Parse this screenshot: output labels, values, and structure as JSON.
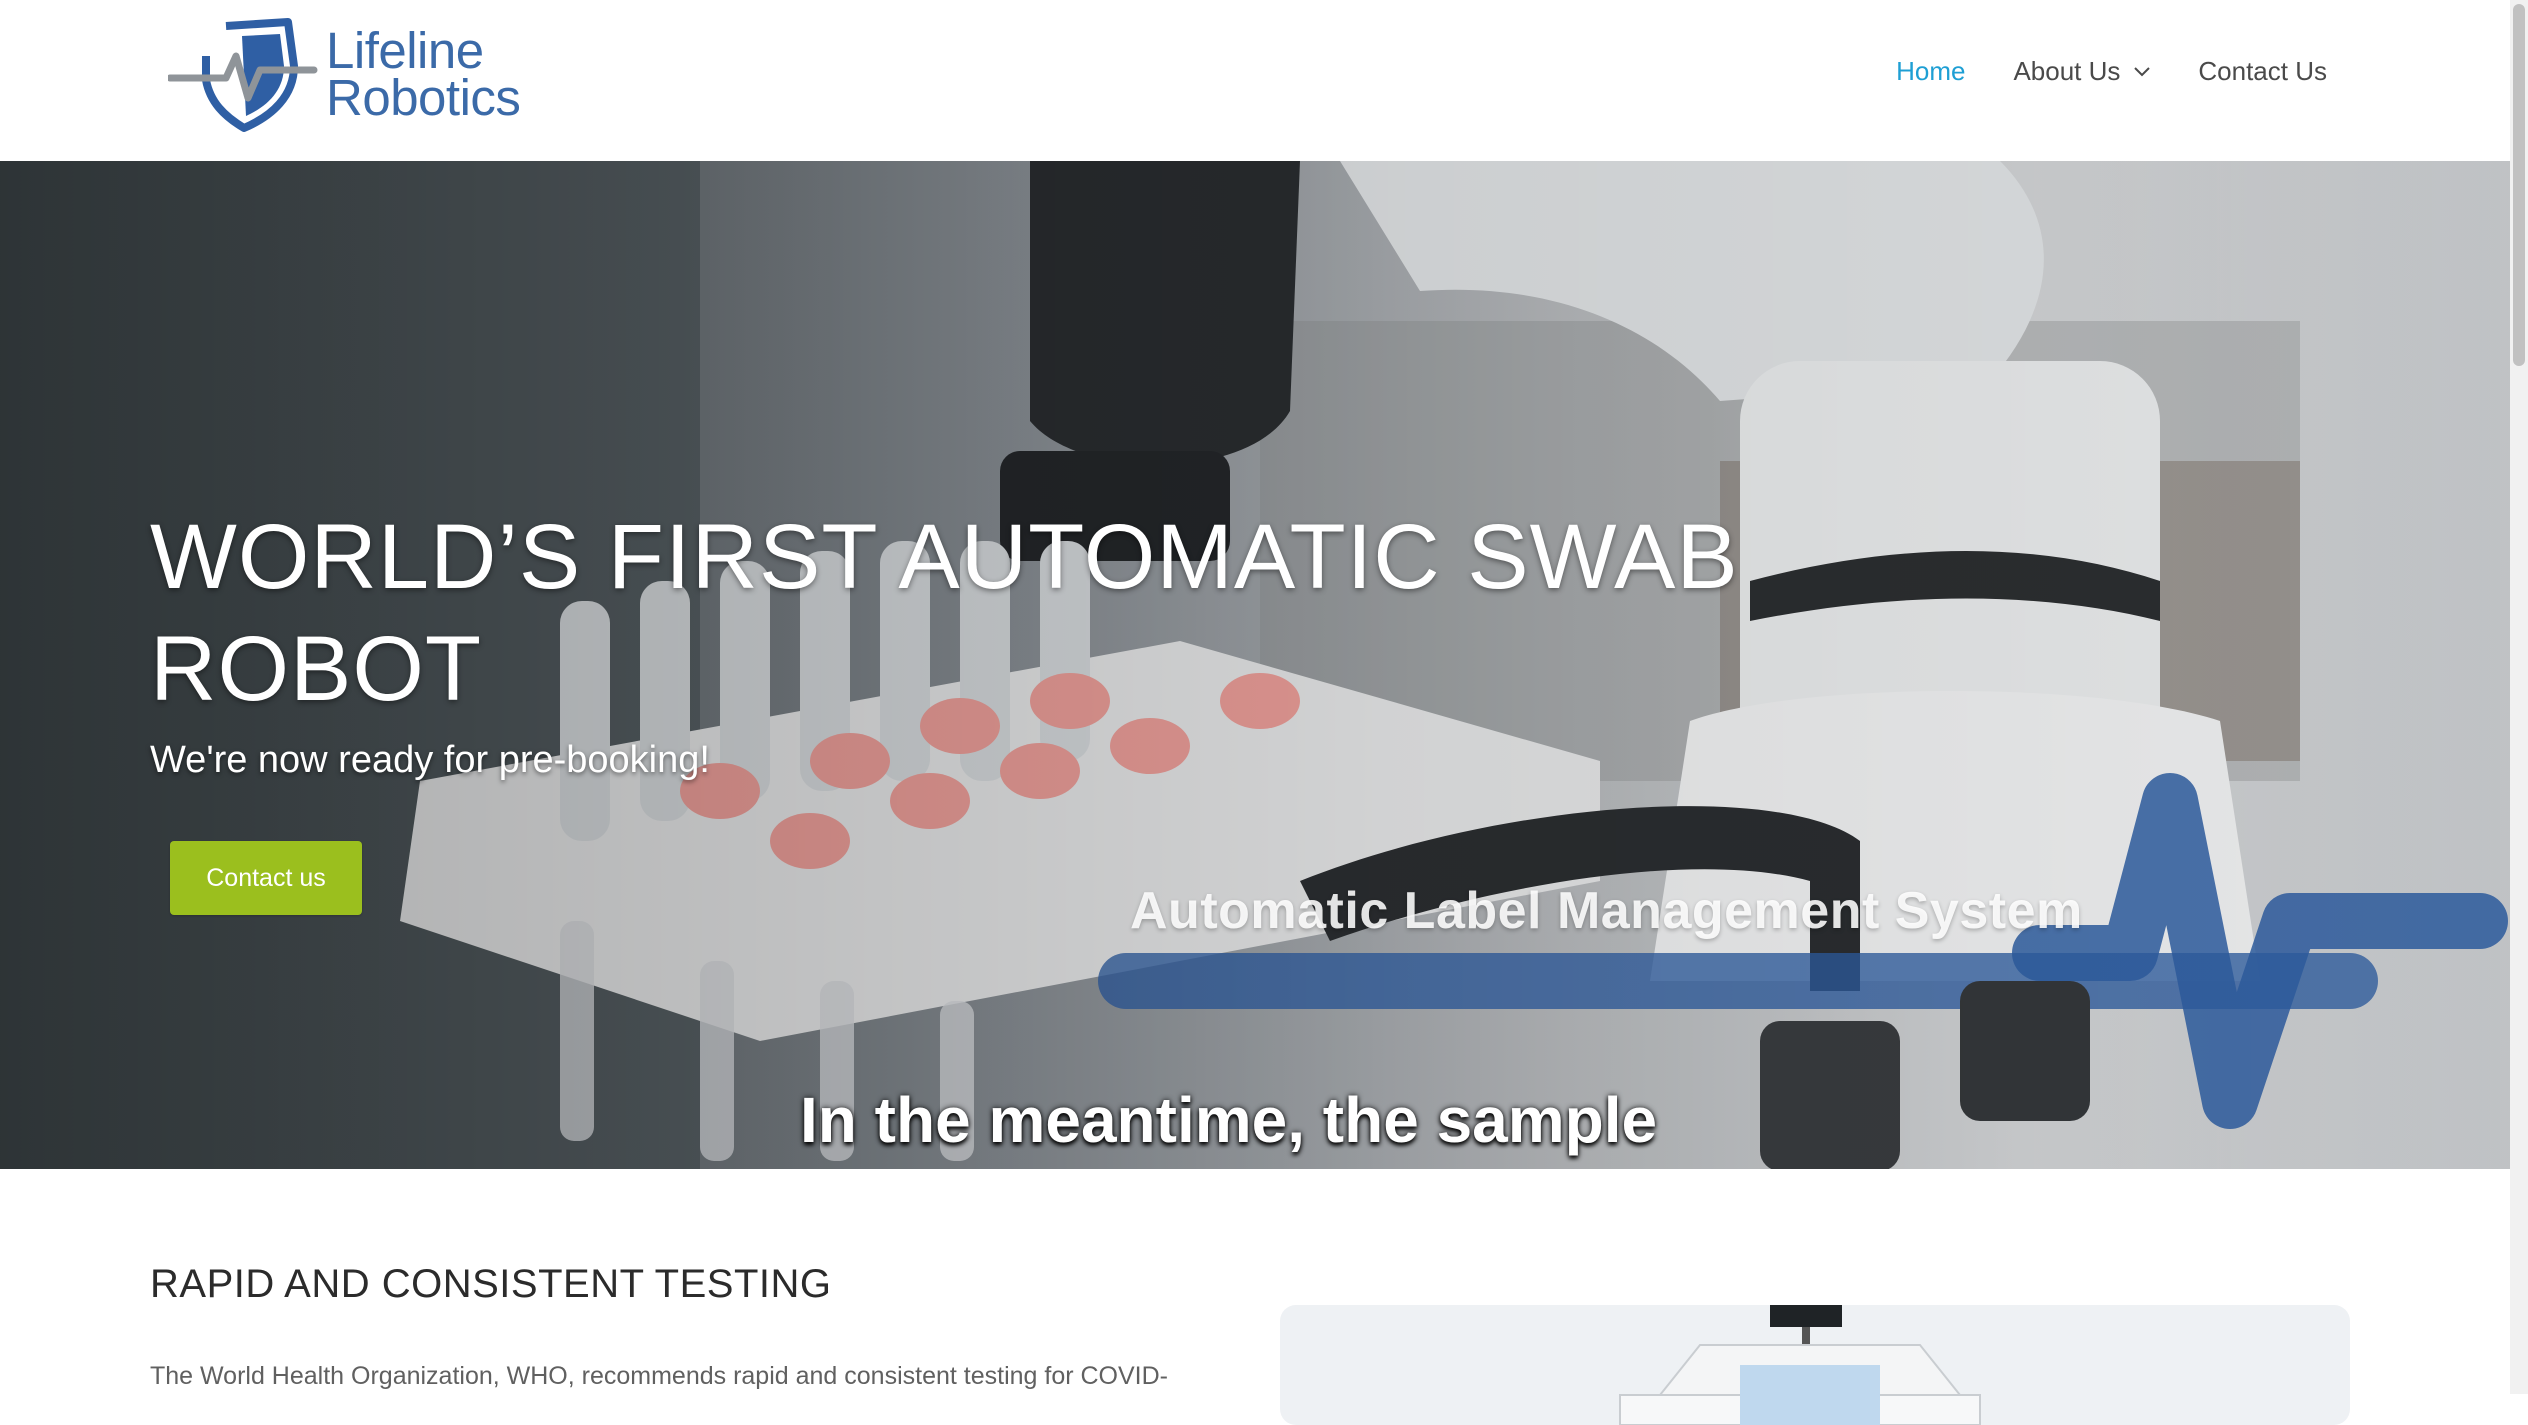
{
  "brand": {
    "line1": "Lifeline",
    "line2": "Robotics",
    "logo_icon": "shield-heartbeat-icon",
    "color": "#3b6aa8"
  },
  "nav": {
    "items": [
      {
        "label": "Home",
        "active": true
      },
      {
        "label": "About Us",
        "has_dropdown": true,
        "icon": "chevron-down-icon"
      },
      {
        "label": "Contact Us"
      }
    ],
    "active_color": "#1e9fd4"
  },
  "hero": {
    "title": "WORLD’S FIRST AUTOMATIC SWAB ROBOT",
    "subtitle": "We're now ready for pre-booking!",
    "cta_label": "Contact us",
    "cta_color": "#9bbf1e",
    "video_overlay_label": "Automatic Label Management System",
    "video_caption": "In the meantime, the sample",
    "slides_count": 4,
    "active_slide": 1
  },
  "section": {
    "title": "RAPID AND CONSISTENT TESTING",
    "text": "The World Health Organization, WHO, recommends rapid and consistent testing for COVID-"
  }
}
